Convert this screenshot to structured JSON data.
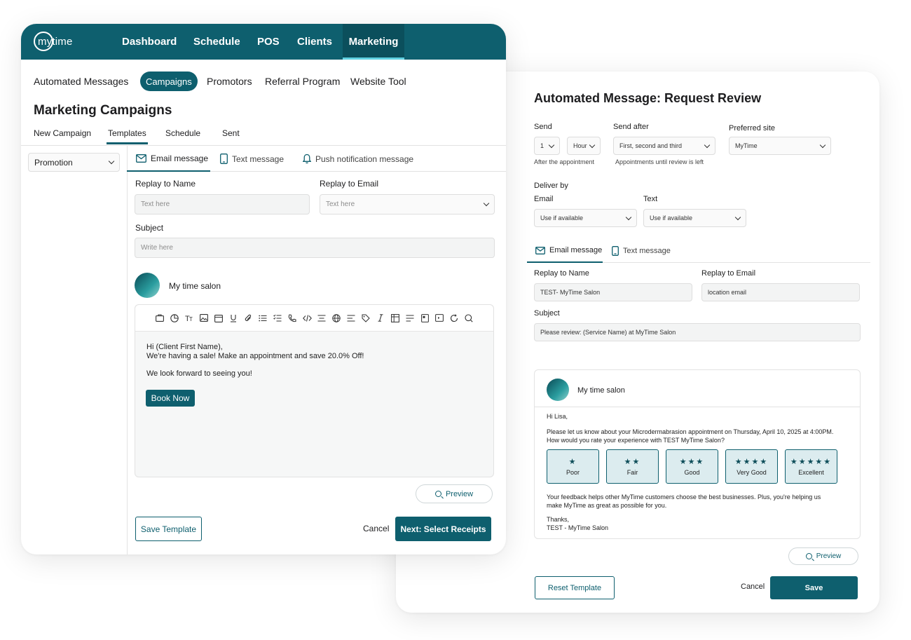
{
  "right": {
    "title": "Automated Message: Request Review",
    "send_label": "Send",
    "send_value": "1",
    "send_unit": "Hour",
    "send_sub": "After the appointment",
    "send_after_label": "Send after",
    "send_after_value": "First, second and third",
    "send_after_sub": "Appointments until review is left",
    "preferred_site_label": "Preferred site",
    "preferred_site_value": "MyTime",
    "deliver_by_label": "Deliver by",
    "email_label": "Email",
    "email_value": "Use if available",
    "text_label": "Text",
    "text_value": "Use if available",
    "tabs": [
      "Email message",
      "Text message"
    ],
    "replay_name_label": "Replay to Name",
    "replay_name_value": "TEST- MyTime Salon",
    "replay_email_label": "Replay to Email",
    "replay_email_value": "location email",
    "subject_label": "Subject",
    "subject_value": "Please review: (Service Name) at MyTime Salon",
    "preview": {
      "salon_name": "My time salon",
      "greeting": "Hi Lisa,",
      "line1": "Please let us know about your Microdermabrasion appointment on Thursday, April 10, 2025 at 4:00PM.",
      "line2": "How would you rate your experience with TEST MyTime Salon?",
      "ratings": [
        {
          "stars": "★",
          "label": "Poor"
        },
        {
          "stars": "★★",
          "label": "Fair"
        },
        {
          "stars": "★★★",
          "label": "Good"
        },
        {
          "stars": "★★★★",
          "label": "Very Good"
        },
        {
          "stars": "★★★★★",
          "label": "Excellent"
        }
      ],
      "feedback1": "Your feedback helps other MyTime customers choose the best businesses. Plus, you're helping us",
      "feedback2": "make MyTime as great as possible for you.",
      "thanks": "Thanks,",
      "signature": "TEST - MyTime Salon"
    },
    "preview_button": "Preview",
    "reset_button": "Reset Template",
    "cancel_button": "Cancel",
    "save_button": "Save"
  },
  "left": {
    "logo": "mytime",
    "nav": [
      "Dashboard",
      "Schedule",
      "POS",
      "Clients",
      "Marketing"
    ],
    "subnav": [
      "Automated Messages",
      "Campaigns",
      "Promotors",
      "Referral Program",
      "Website Tool"
    ],
    "title": "Marketing Campaigns",
    "tabs": [
      "New Campaign",
      "Templates",
      "Schedule",
      "Sent"
    ],
    "category_select": "Promotion",
    "message_tabs": [
      "Email message",
      "Text message",
      "Push notification message"
    ],
    "replay_name_label": "Replay to Name",
    "replay_name_placeholder": "Text here",
    "replay_email_label": "Replay to Email",
    "replay_email_placeholder": "Text here",
    "subject_label": "Subject",
    "subject_placeholder": "Write here",
    "salon_name": "My time salon",
    "body_line1": "Hi (Client First Name),",
    "body_line2": "We're having a sale! Make an appointment and save 20.0% Off!",
    "body_line3": "We look forward to seeing you!",
    "book_button": "Book Now",
    "preview_button": "Preview",
    "save_template_button": "Save Template",
    "cancel_button": "Cancel",
    "next_button": "Next: Select Receipts"
  },
  "colors": {
    "brand": "#0e5f6e",
    "accent": "#5fd0e0"
  }
}
